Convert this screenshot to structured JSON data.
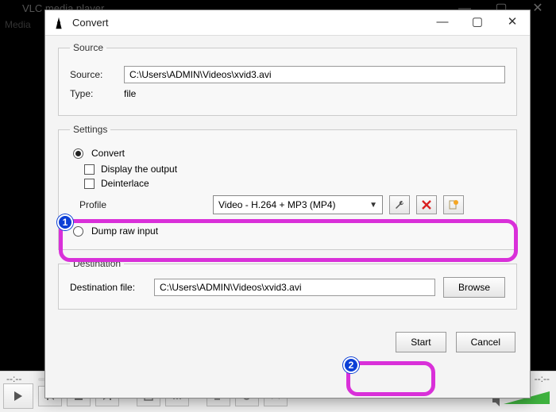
{
  "parent": {
    "title": "VLC media player",
    "menu_media": "Media",
    "time_left": "--:--",
    "time_right": "--:--"
  },
  "dialog": {
    "title": "Convert",
    "source": {
      "legend": "Source",
      "source_label": "Source:",
      "source_value": "C:\\Users\\ADMIN\\Videos\\xvid3.avi",
      "type_label": "Type:",
      "type_value": "file"
    },
    "settings": {
      "legend": "Settings",
      "convert_label": "Convert",
      "display_output_label": "Display the output",
      "deinterlace_label": "Deinterlace",
      "profile_label": "Profile",
      "profile_value": "Video - H.264 + MP3 (MP4)",
      "dump_label": "Dump raw input"
    },
    "destination": {
      "legend": "Destination",
      "dest_label": "Destination file:",
      "dest_value": "C:\\Users\\ADMIN\\Videos\\xvid3.avi",
      "browse_label": "Browse"
    },
    "buttons": {
      "start": "Start",
      "cancel": "Cancel"
    }
  },
  "annotations": {
    "badge1": "1",
    "badge2": "2"
  }
}
